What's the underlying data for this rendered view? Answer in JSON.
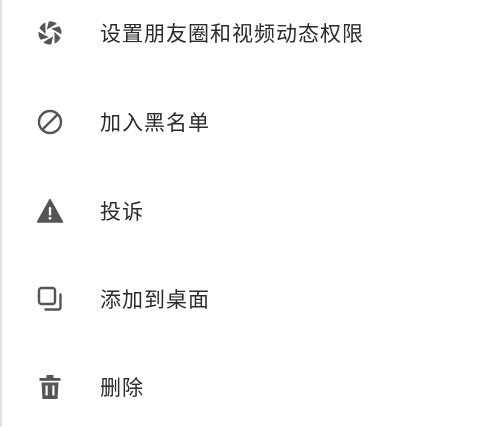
{
  "colors": {
    "icon": "#555555",
    "label": "#2b2b2b",
    "background": "#ffffff",
    "edge": "#e2e2e2"
  },
  "menu": {
    "items": [
      {
        "label": "设置朋友圈和视频动态权限",
        "icon": "aperture-icon"
      },
      {
        "label": "加入黑名单",
        "icon": "block-icon"
      },
      {
        "label": "投诉",
        "icon": "warning-icon"
      },
      {
        "label": "添加到桌面",
        "icon": "add-to-desktop-icon"
      },
      {
        "label": "删除",
        "icon": "trash-icon"
      }
    ]
  }
}
